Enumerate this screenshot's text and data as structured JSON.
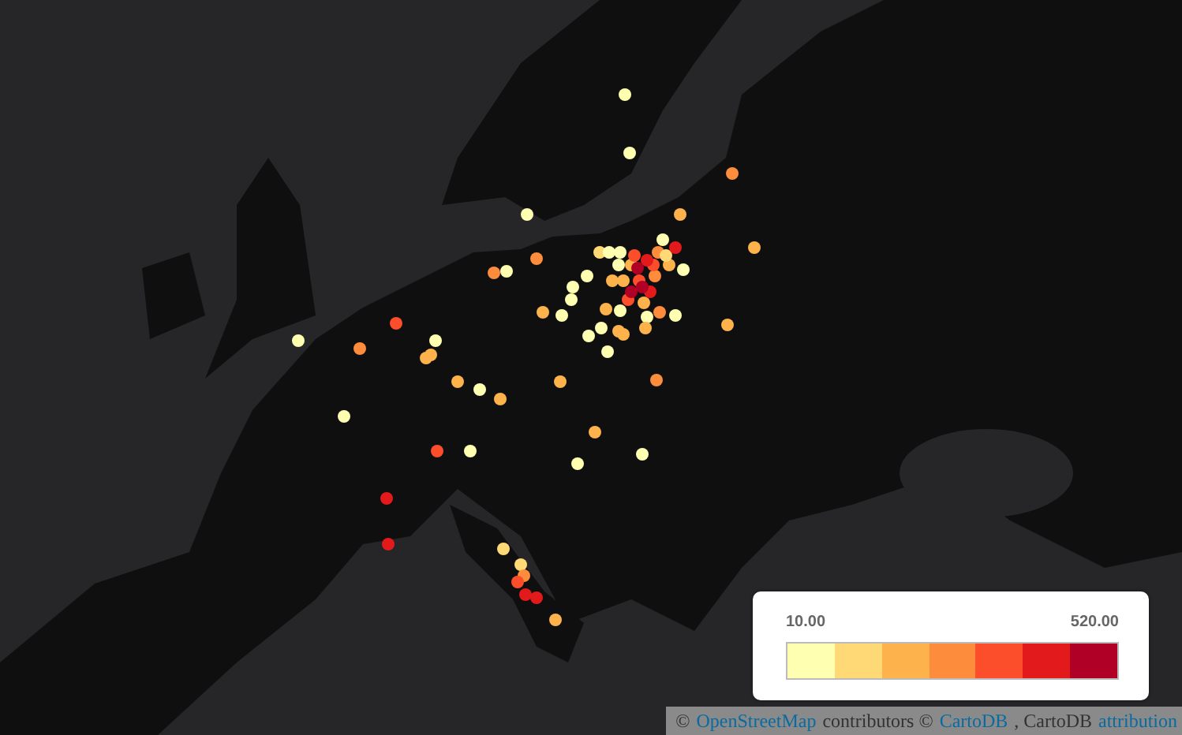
{
  "legend": {
    "min_label": "10.00",
    "max_label": "520.00",
    "steps": [
      {
        "color": "#ffffb2"
      },
      {
        "color": "#fed976"
      },
      {
        "color": "#feb24c"
      },
      {
        "color": "#fd8d3c"
      },
      {
        "color": "#fc4e2a"
      },
      {
        "color": "#e31a1c"
      },
      {
        "color": "#b10026"
      }
    ]
  },
  "attribution": [
    {
      "kind": "text",
      "text": "©"
    },
    {
      "kind": "link",
      "text": "OpenStreetMap"
    },
    {
      "kind": "text",
      "text": "contributors ©"
    },
    {
      "kind": "link",
      "text": "CartoDB"
    },
    {
      "kind": "text",
      "text": ", CartoDB"
    },
    {
      "kind": "link",
      "text": "attribution"
    }
  ]
}
